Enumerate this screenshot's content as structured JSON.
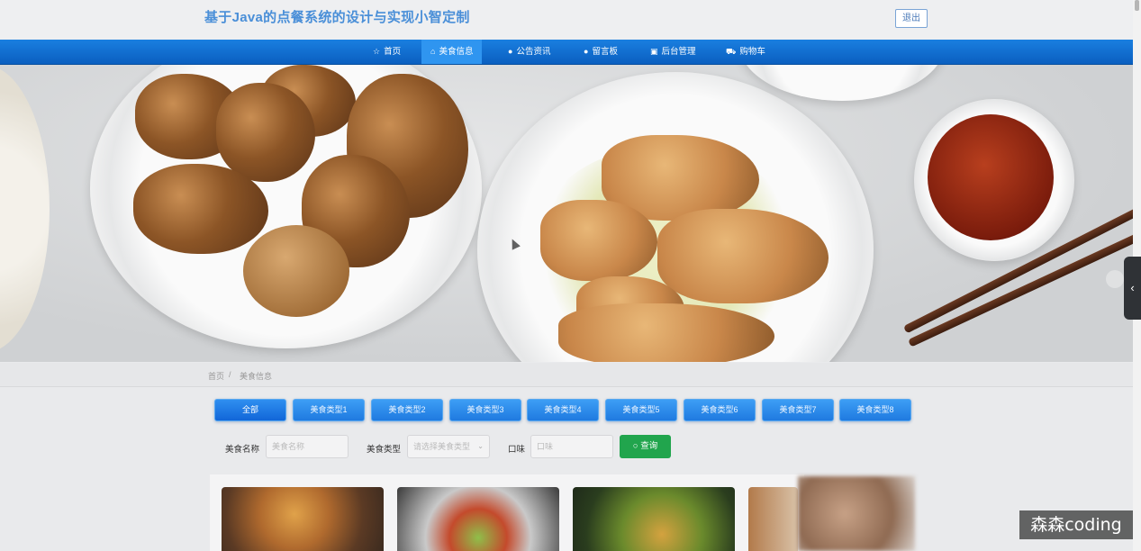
{
  "header": {
    "title": "基于Java的点餐系统的设计与实现小智定制",
    "logout_label": "退出"
  },
  "nav": {
    "items": [
      {
        "label": "首页",
        "icon": "star-icon"
      },
      {
        "label": "美食信息",
        "icon": "home-icon",
        "active": true
      },
      {
        "label": "公告资讯",
        "icon": "info-icon"
      },
      {
        "label": "留言板",
        "icon": "circle-icon"
      },
      {
        "label": "后台管理",
        "icon": "panel-icon"
      },
      {
        "label": "购物车",
        "icon": "cart-icon"
      }
    ]
  },
  "breadcrumb": {
    "home": "首页",
    "separator": "/",
    "current": "美食信息"
  },
  "categories": {
    "items": [
      "全部",
      "美食类型1",
      "美食类型2",
      "美食类型3",
      "美食类型4",
      "美食类型5",
      "美食类型6",
      "美食类型7",
      "美食类型8"
    ]
  },
  "filters": {
    "name_label": "美食名称",
    "name_placeholder": "美食名称",
    "type_label": "美食类型",
    "type_placeholder": "请选择美食类型",
    "taste_label": "口味",
    "taste_placeholder": "口味",
    "search_label": "查询"
  },
  "watermark": "森森coding",
  "colors": {
    "nav_bg": "#0a6fd6",
    "accent_blue": "#1f7ae0",
    "search_green": "#21a54d",
    "title_blue": "#4a8fd8"
  }
}
